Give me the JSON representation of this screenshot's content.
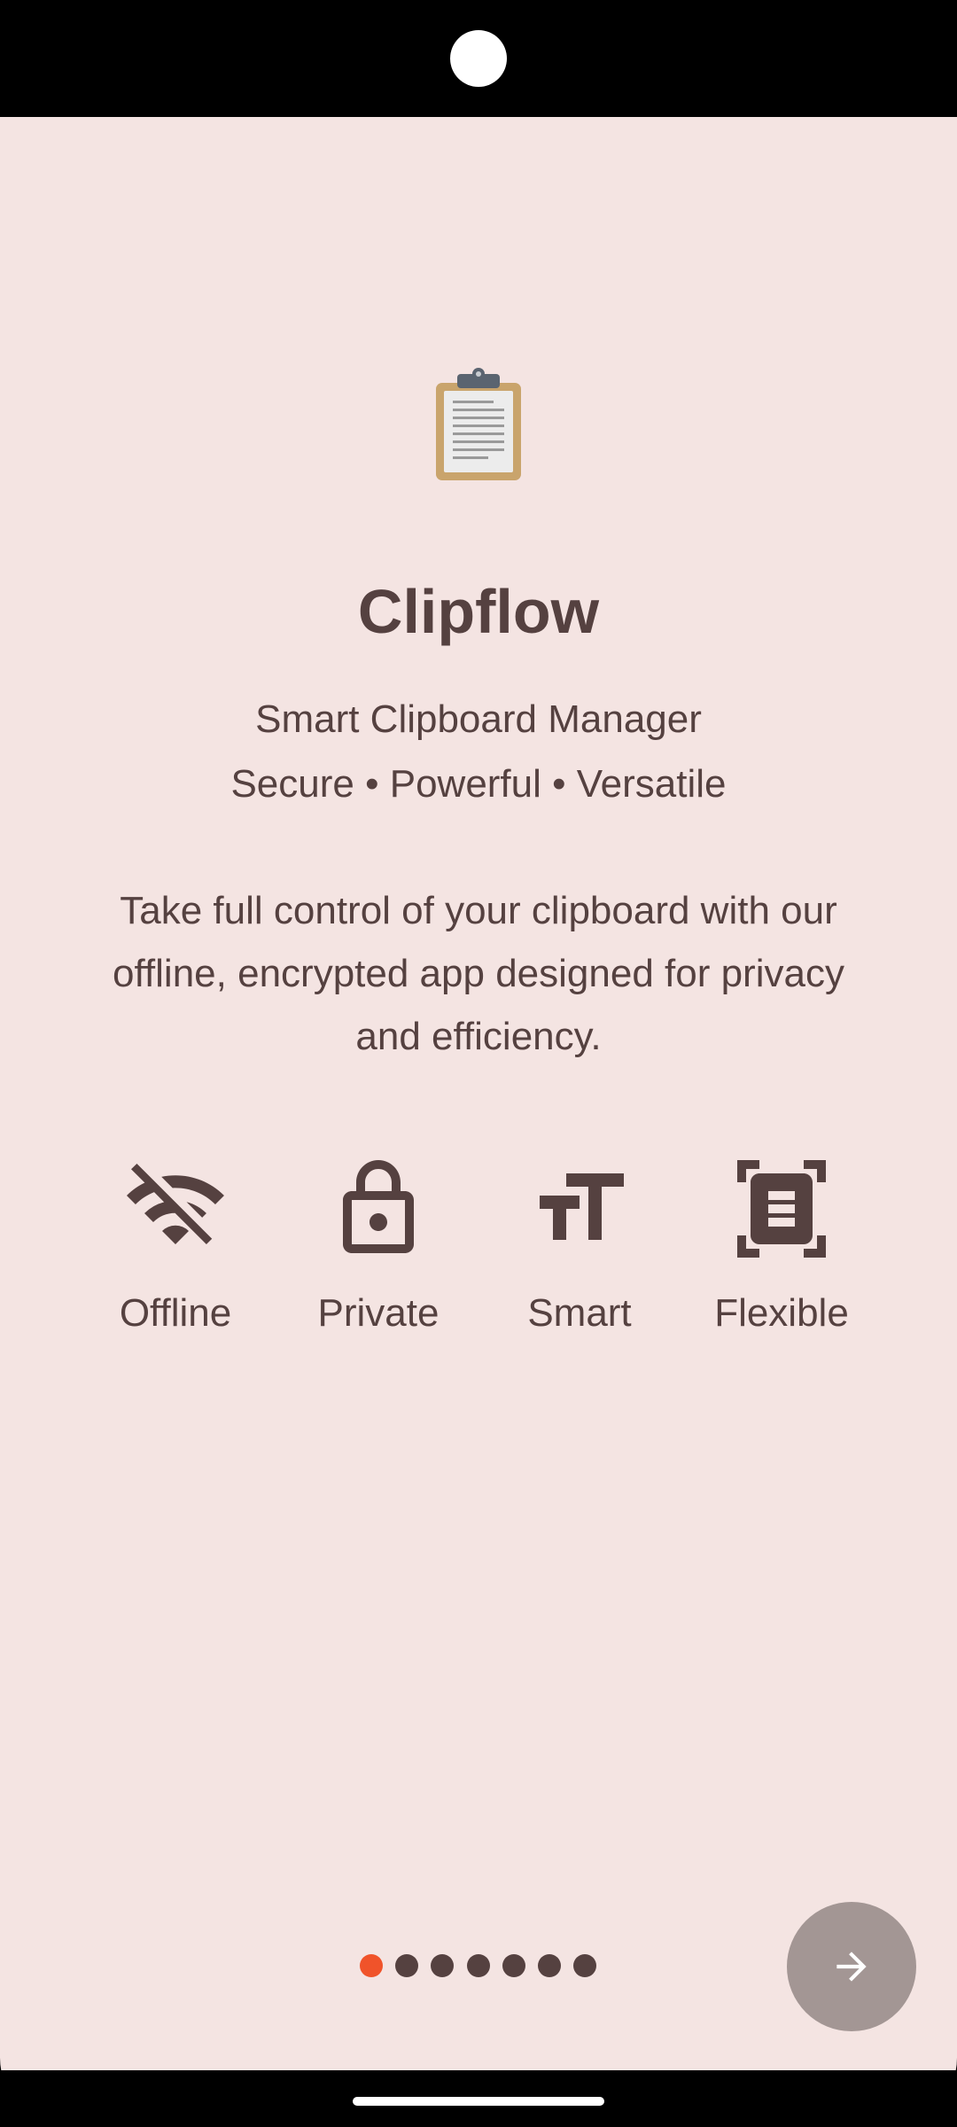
{
  "app": {
    "title": "Clipflow",
    "subtitle_line1": "Smart Clipboard Manager",
    "subtitle_line2": "Secure • Powerful • Versatile",
    "description": "Take full control of your clipboard with our offline, encrypted app designed for privacy and efficiency.",
    "icon": "clipboard-icon"
  },
  "features": [
    {
      "label": "Offline",
      "icon": "wifi-off-icon"
    },
    {
      "label": "Private",
      "icon": "lock-icon"
    },
    {
      "label": "Smart",
      "icon": "text-size-icon"
    },
    {
      "label": "Flexible",
      "icon": "document-scanner-icon"
    }
  ],
  "pager": {
    "total_pages": 7,
    "current_page": 1
  },
  "next_button": {
    "icon": "arrow-right-icon"
  },
  "colors": {
    "background": "#f4e4e2",
    "text": "#554140",
    "accent": "#f0532a",
    "fab": "#a39694"
  }
}
